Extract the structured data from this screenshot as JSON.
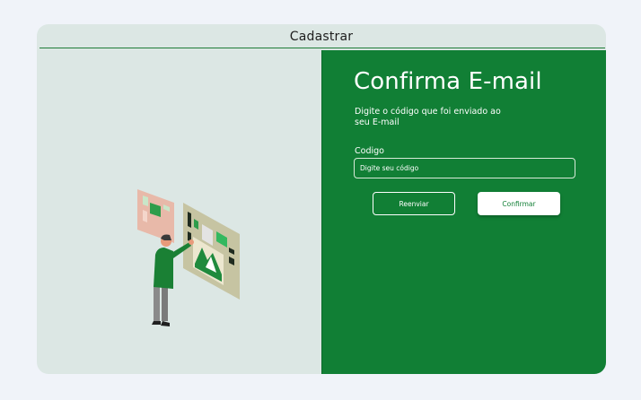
{
  "topbar": {
    "title": "Cadastrar"
  },
  "confirm": {
    "heading": "Confirma E-mail",
    "subtitle": "Digite o código que foi enviado ao seu E-mail",
    "code_label": "Codigo",
    "code_placeholder": "Digite seu código",
    "resend_label": "Reenviar",
    "confirm_label": "Confirmar"
  },
  "colors": {
    "brand_green": "#117f35",
    "card_background": "#dce7e4",
    "page_background": "#f0f3f9"
  }
}
